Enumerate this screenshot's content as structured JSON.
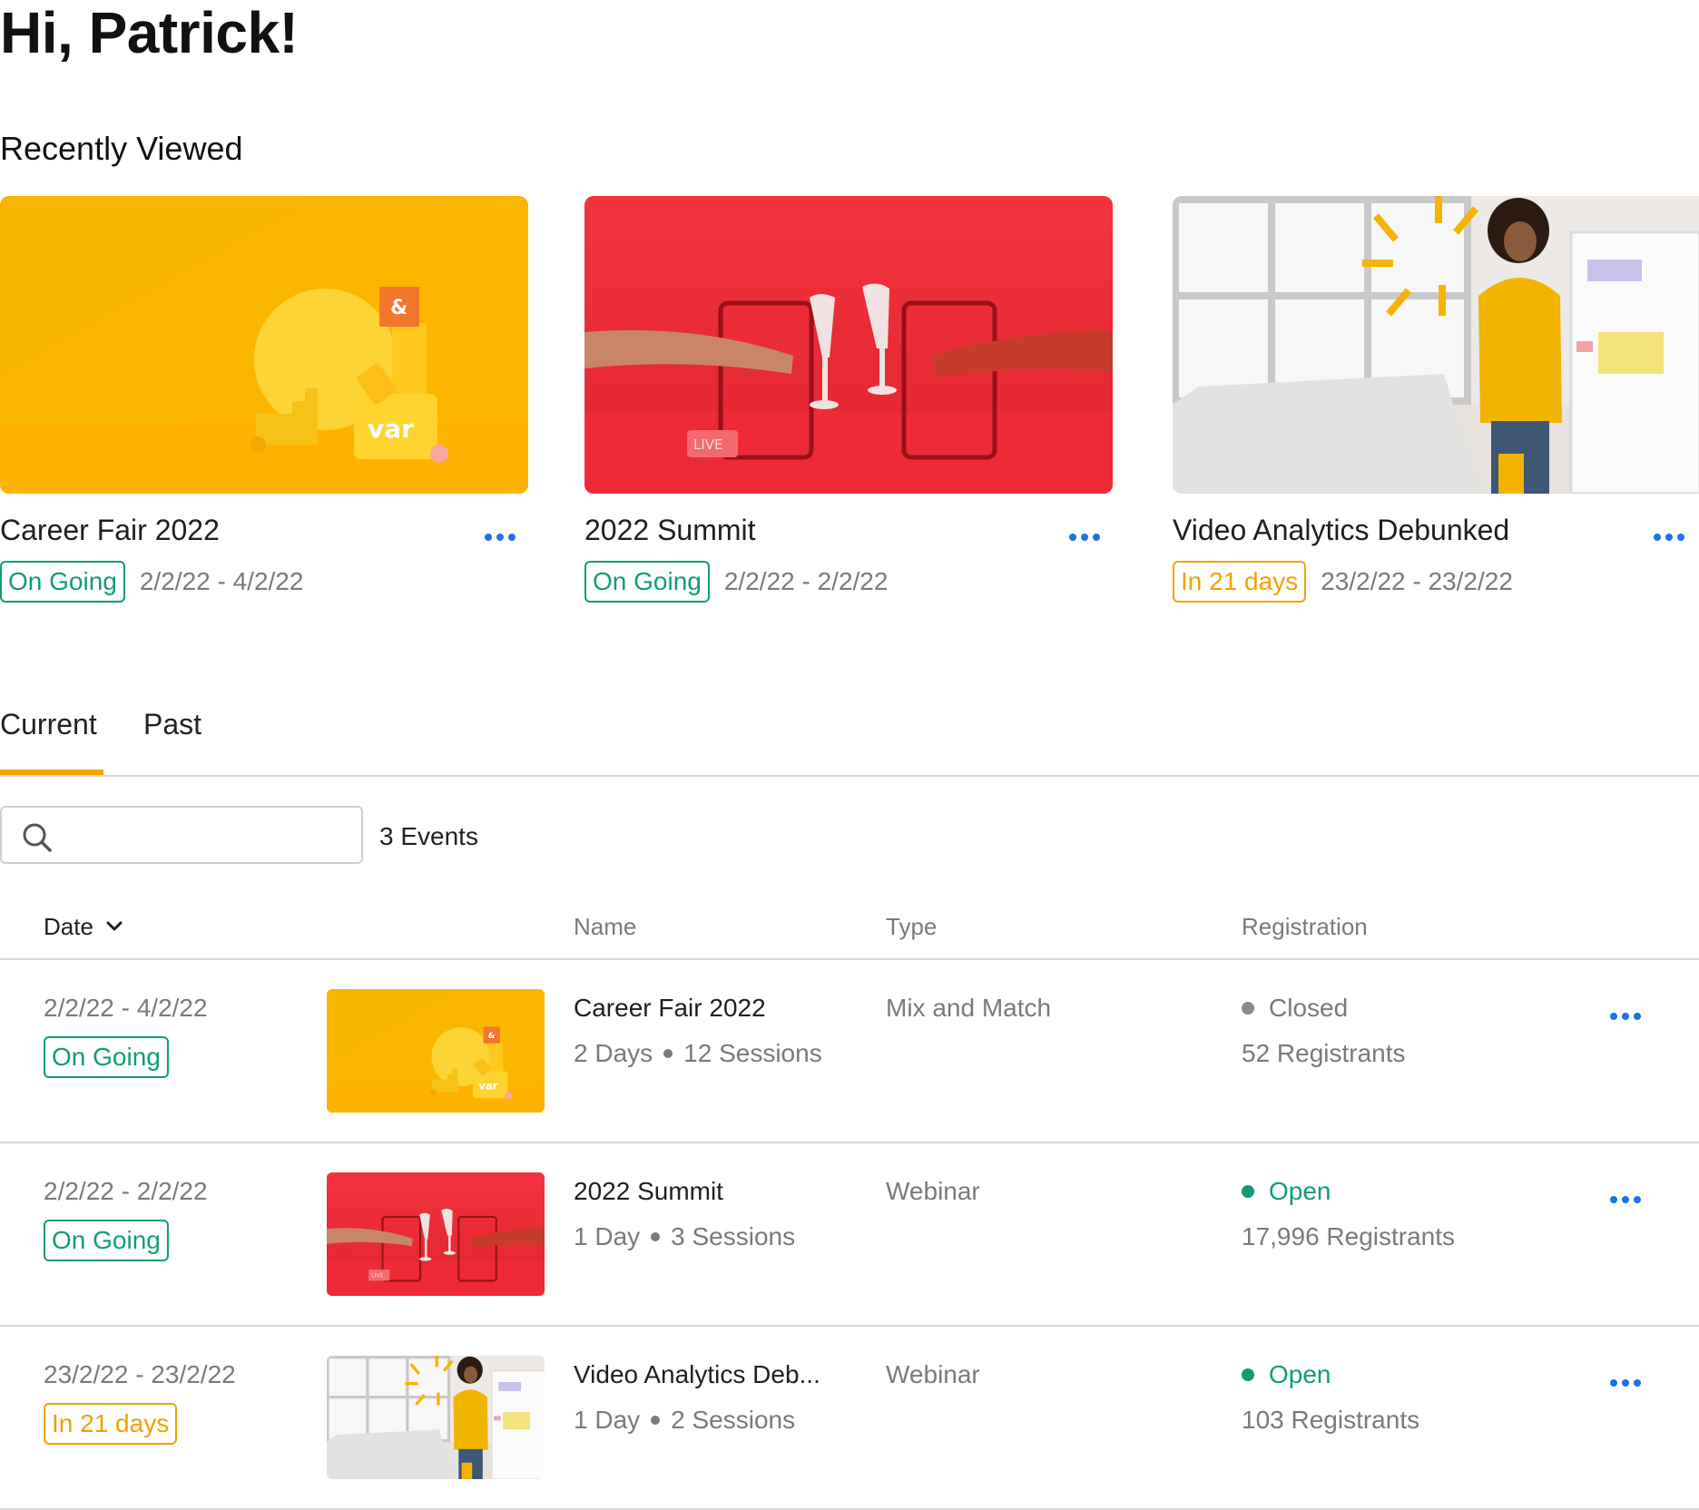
{
  "greeting": "Hi, Patrick!",
  "recently_viewed": {
    "title": "Recently Viewed",
    "cards": [
      {
        "title": "Career Fair 2022",
        "status": "On Going",
        "status_color": "#0f9d77",
        "dates": "2/2/22 - 4/2/22",
        "image": "yellow-career-fair-scene"
      },
      {
        "title": "2022 Summit",
        "status": "On Going",
        "status_color": "#0f9d77",
        "dates": "2/2/22 - 2/2/22",
        "image": "red-toast-live-scene",
        "live_label": "LIVE"
      },
      {
        "title": "Video Analytics Debunked",
        "status": "In 21 days",
        "status_color": "#f2a100",
        "dates": "23/2/22 - 23/2/22",
        "image": "presenter-office-scene"
      }
    ]
  },
  "tabs": [
    {
      "label": "Current",
      "active": true
    },
    {
      "label": "Past",
      "active": false
    }
  ],
  "search": {
    "placeholder": "",
    "value": ""
  },
  "events_count": "3 Events",
  "table": {
    "columns": {
      "date": "Date",
      "name": "Name",
      "type": "Type",
      "registration": "Registration"
    },
    "rows": [
      {
        "dates": "2/2/22 - 4/2/22",
        "status": "On Going",
        "name": "Career Fair 2022",
        "days": "2 Days",
        "sessions": "12 Sessions",
        "type": "Mix and Match",
        "reg_status": "Closed",
        "reg_color": "#8a8a8a",
        "registrants": "52 Registrants"
      },
      {
        "dates": "2/2/22 - 2/2/22",
        "status": "On Going",
        "name": "2022 Summit",
        "days": "1 Day",
        "sessions": "3 Sessions",
        "type": "Webinar",
        "reg_status": "Open",
        "reg_color": "#0f9d77",
        "registrants": "17,996 Registrants"
      },
      {
        "dates": "23/2/22 - 23/2/22",
        "status": "In 21 days",
        "name": "Video Analytics Deb...",
        "days": "1 Day",
        "sessions": "2 Sessions",
        "type": "Webinar",
        "reg_status": "Open",
        "reg_color": "#0f9d77",
        "registrants": "103 Registrants"
      }
    ]
  },
  "colors": {
    "accent": "#f4a300",
    "link": "#1a73e8",
    "green": "#0f9d77",
    "orange": "#f2a100"
  }
}
